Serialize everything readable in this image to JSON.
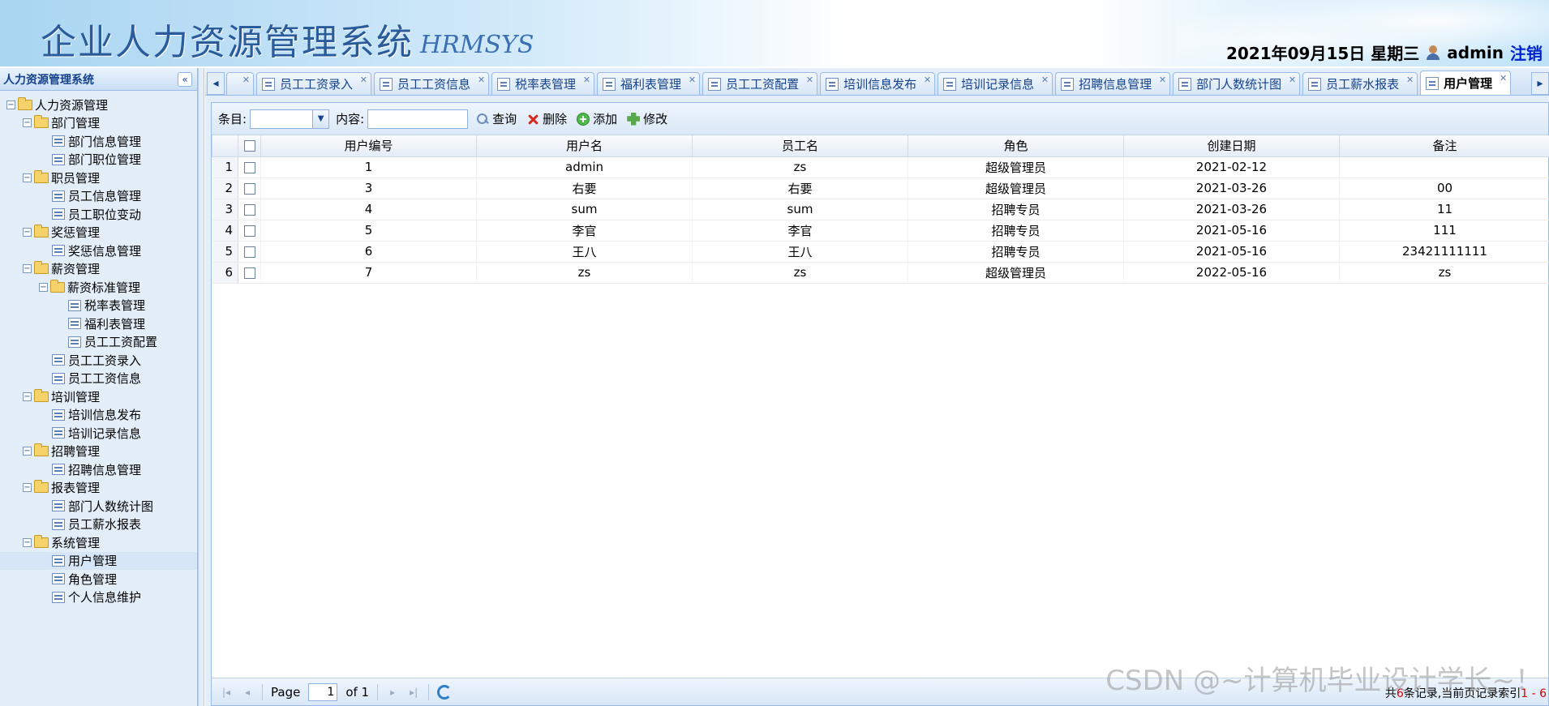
{
  "header": {
    "title": "企业人力资源管理系统",
    "subtitle": "HRMSYS",
    "date": "2021年09月15日 星期三",
    "username": "admin",
    "logout": "注销"
  },
  "sidebar": {
    "title": "人力资源管理系统",
    "root": "人力资源管理",
    "groups": {
      "dept": {
        "label": "部门管理",
        "items": [
          "部门信息管理",
          "部门职位管理"
        ]
      },
      "staff": {
        "label": "职员管理",
        "items": [
          "员工信息管理",
          "员工职位变动"
        ]
      },
      "reward": {
        "label": "奖惩管理",
        "items": [
          "奖惩信息管理"
        ]
      },
      "salary": {
        "label": "薪资管理",
        "sub": "薪资标准管理",
        "subitems": [
          "税率表管理",
          "福利表管理",
          "员工工资配置"
        ],
        "items": [
          "员工工资录入",
          "员工工资信息"
        ]
      },
      "train": {
        "label": "培训管理",
        "items": [
          "培训信息发布",
          "培训记录信息"
        ]
      },
      "recruit": {
        "label": "招聘管理",
        "items": [
          "招聘信息管理"
        ]
      },
      "report": {
        "label": "报表管理",
        "items": [
          "部门人数统计图",
          "员工薪水报表"
        ]
      },
      "system": {
        "label": "系统管理",
        "items": [
          "用户管理",
          "角色管理",
          "个人信息维护"
        ]
      }
    }
  },
  "tabs": [
    "员工工资录入",
    "员工工资信息",
    "税率表管理",
    "福利表管理",
    "员工工资配置",
    "培训信息发布",
    "培训记录信息",
    "招聘信息管理",
    "部门人数统计图",
    "员工薪水报表",
    "用户管理"
  ],
  "toolbar": {
    "field_label": "条目:",
    "content_label": "内容:",
    "search": "查询",
    "delete": "删除",
    "add": "添加",
    "edit": "修改"
  },
  "table": {
    "columns": [
      "用户编号",
      "用户名",
      "员工名",
      "角色",
      "创建日期",
      "备注"
    ],
    "rows": [
      [
        "1",
        "1",
        "admin",
        "zs",
        "超级管理员",
        "2021-02-12",
        ""
      ],
      [
        "2",
        "3",
        "右要",
        "右要",
        "超级管理员",
        "2021-03-26",
        "00"
      ],
      [
        "3",
        "4",
        "sum",
        "sum",
        "招聘专员",
        "2021-03-26",
        "11"
      ],
      [
        "4",
        "5",
        "李官",
        "李官",
        "招聘专员",
        "2021-05-16",
        "111"
      ],
      [
        "5",
        "6",
        "王八",
        "王八",
        "招聘专员",
        "2021-05-16",
        "23421111111"
      ],
      [
        "6",
        "7",
        "zs",
        "zs",
        "超级管理员",
        "2022-05-16",
        "zs"
      ]
    ]
  },
  "pager": {
    "page_label": "Page",
    "page_value": "1",
    "of_label": "of 1",
    "info_prefix": "共",
    "info_count": "6",
    "info_middle": "条记录,当前页记录索引",
    "info_range": "1 - 6"
  },
  "watermark": "CSDN @~计算机毕业设计学长~！"
}
